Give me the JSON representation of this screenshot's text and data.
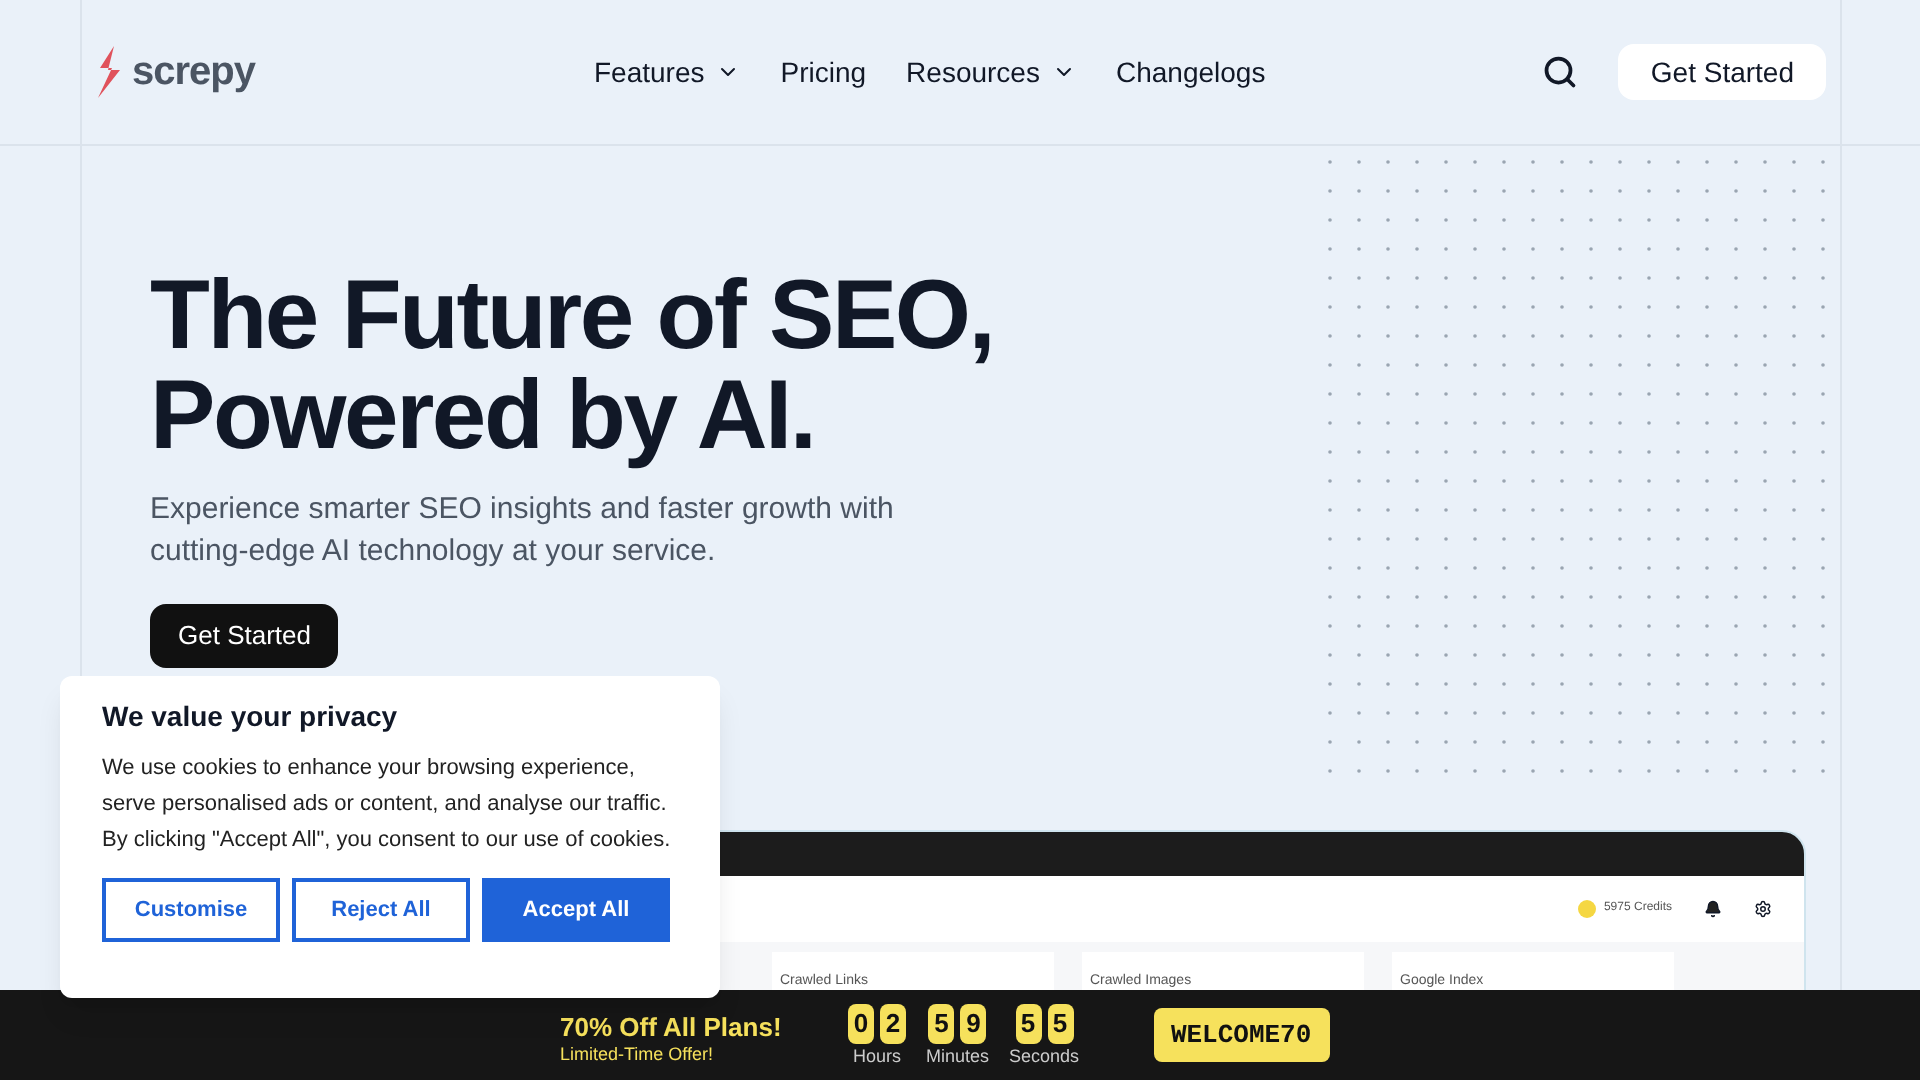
{
  "header": {
    "logo": "screpy",
    "nav": [
      {
        "label": "Features",
        "dropdown": true
      },
      {
        "label": "Pricing",
        "dropdown": false
      },
      {
        "label": "Resources",
        "dropdown": true
      },
      {
        "label": "Changelogs",
        "dropdown": false
      }
    ],
    "cta": "Get Started"
  },
  "hero": {
    "title_lines": [
      "The Future of SEO,",
      "Powered by AI."
    ],
    "subtitle_lines": [
      "Experience smarter SEO insights and faster growth with",
      "cutting-edge AI technology at your service."
    ],
    "cta": "Get Started"
  },
  "dashboard": {
    "credits": "5975 Credits",
    "cards": [
      "Crawled Links",
      "Crawled Images",
      "Google Index"
    ]
  },
  "cookie": {
    "title": "We value your privacy",
    "text": "We use cookies to enhance your browsing experience, serve personalised ads or content, and analyse our traffic. By clicking \"Accept All\", you consent to our use of cookies.",
    "buttons": [
      {
        "label": "Customise",
        "primary": false
      },
      {
        "label": "Reject All",
        "primary": false
      },
      {
        "label": "Accept All",
        "primary": true
      }
    ]
  },
  "promo": {
    "headline": "70% Off All Plans!",
    "subline": "Limited-Time Offer!",
    "countdown": [
      {
        "digits": [
          "0",
          "2"
        ],
        "unit": "Hours"
      },
      {
        "digits": [
          "5",
          "9"
        ],
        "unit": "Minutes"
      },
      {
        "digits": [
          "5",
          "5"
        ],
        "unit": "Seconds"
      }
    ],
    "code": "WELCOME70"
  }
}
